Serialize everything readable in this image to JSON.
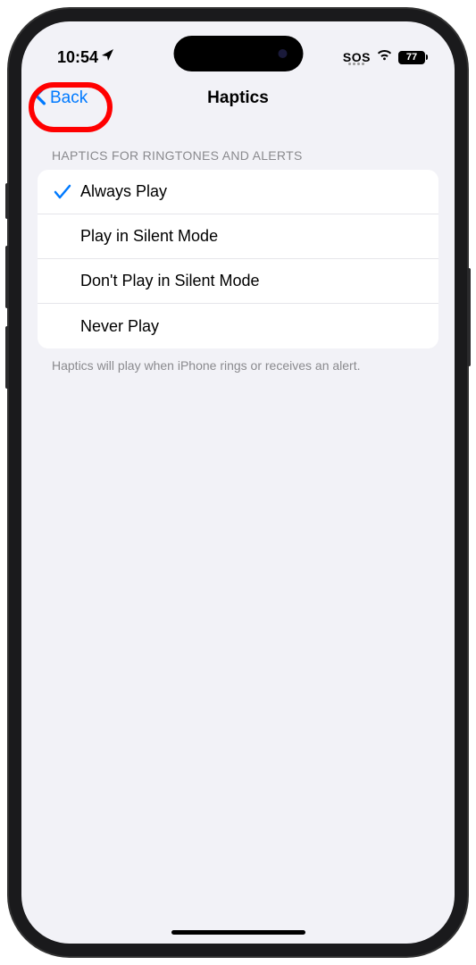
{
  "status": {
    "time": "10:54",
    "sos": "SOS",
    "battery": "77"
  },
  "nav": {
    "back": "Back",
    "title": "Haptics"
  },
  "section": {
    "header": "HAPTICS FOR RINGTONES AND ALERTS",
    "footer": "Haptics will play when iPhone rings or receives an alert."
  },
  "options": {
    "always": "Always Play",
    "silent": "Play in Silent Mode",
    "notsilent": "Don't Play in Silent Mode",
    "never": "Never Play"
  }
}
